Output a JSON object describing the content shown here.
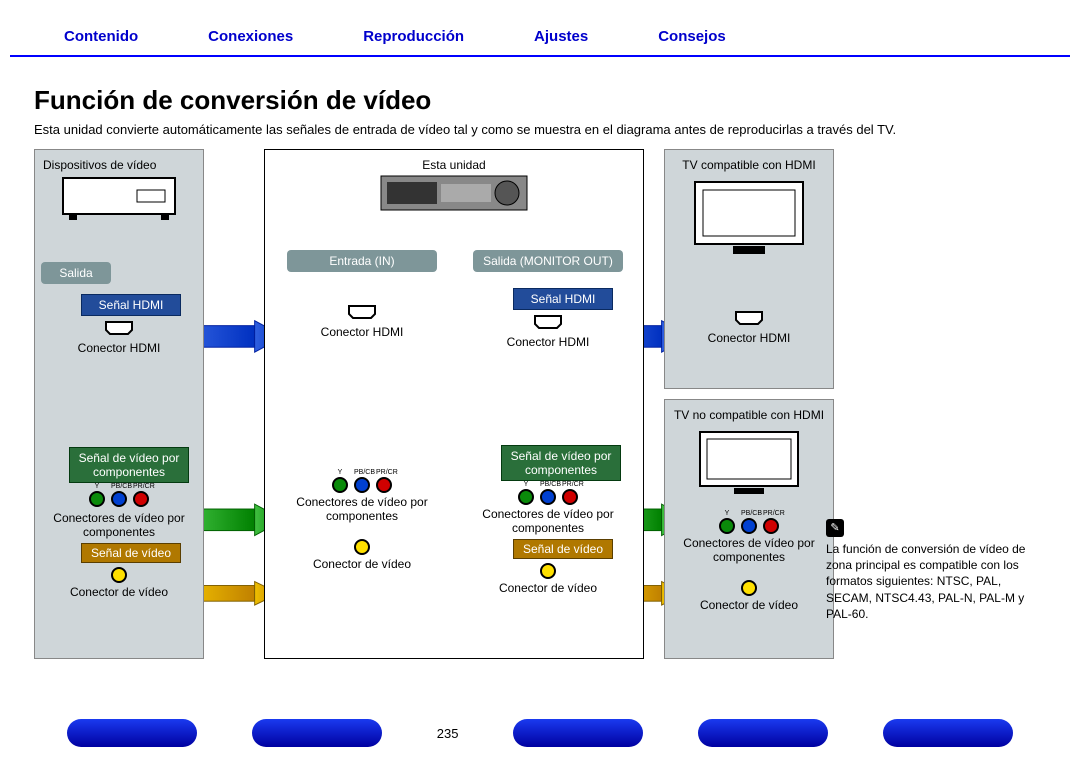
{
  "nav": {
    "contenido": "Contenido",
    "conexiones": "Conexiones",
    "reproduccion": "Reproducción",
    "ajustes": "Ajustes",
    "consejos": "Consejos"
  },
  "title": "Función de conversión de vídeo",
  "intro": "Esta unidad convierte automáticamente las señales de entrada de vídeo tal y como se muestra en el diagrama antes de reproducirlas a través del TV.",
  "col1": {
    "header": "Dispositivos de vídeo",
    "salida": "Salida",
    "hdmi_conn": "Conector HDMI",
    "comp_conn": "Conectores de vídeo por componentes",
    "vid_conn": "Conector de vídeo"
  },
  "col2": {
    "header": "Esta unidad",
    "inL": "Entrada (IN)",
    "inR": "Salida (MONITOR OUT)",
    "hdmi_conn": "Conector HDMI",
    "comp_conn": "Conectores de vídeo por componentes",
    "vid_conn": "Conector de vídeo"
  },
  "col3": {
    "tv_hdmi": "TV compatible con HDMI",
    "tv_no_hdmi": "TV no compatible con HDMI",
    "hdmi_conn": "Conector HDMI",
    "comp_conn": "Conectores de vídeo por componentes",
    "vid_conn": "Conector de vídeo"
  },
  "signals": {
    "hdmi": "Señal HDMI",
    "comp": "Señal de vídeo por componentes",
    "vid": "Señal de vídeo"
  },
  "rca": {
    "y": "Y",
    "pb": "PB/CB",
    "pr": "PR/CR"
  },
  "note": "La función de conversión de vídeo de zona principal es compatible con los formatos siguientes: NTSC, PAL, SECAM, NTSC4.43, PAL-N, PAL-M y PAL-60.",
  "pagenum": "235"
}
